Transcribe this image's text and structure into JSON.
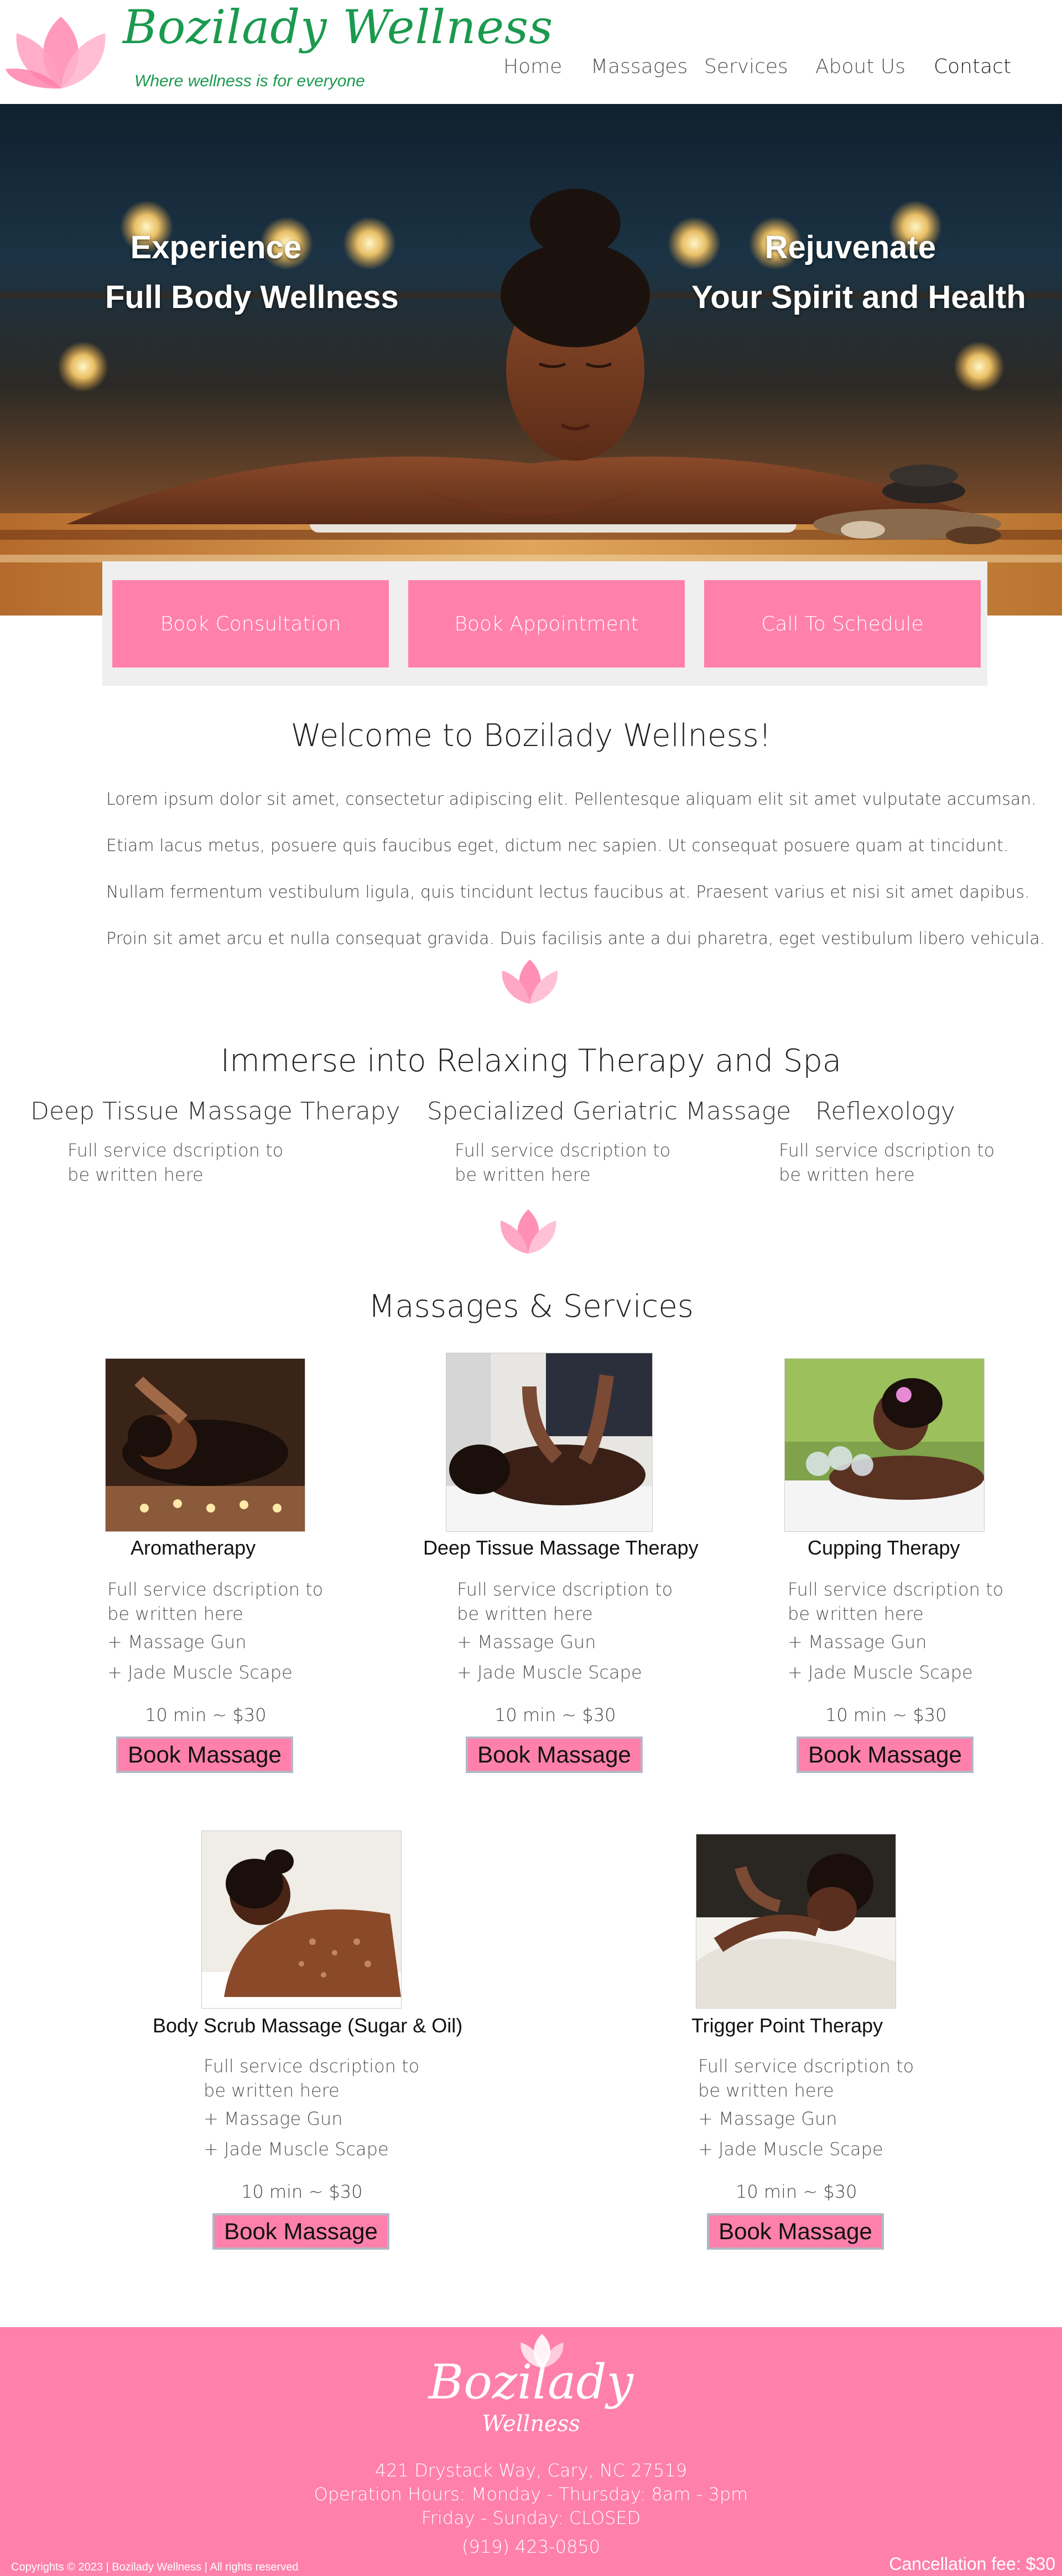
{
  "header": {
    "brand_name": "Bozilady Wellness",
    "tagline": "Where wellness is for everyone",
    "nav": [
      "Home",
      "Massages",
      "Services",
      "About Us",
      "Contact"
    ],
    "colors": {
      "brand_green": "#1a9a4e",
      "accent_pink": "#ff80ab"
    }
  },
  "hero": {
    "left_line1": "Experience",
    "left_line2": "Full Body Wellness",
    "right_line1": "Rejuvenate",
    "right_line2": "Your Spirit and Health"
  },
  "cta": [
    "Book Consultation",
    "Book Appointment",
    "Call To Schedule"
  ],
  "welcome": {
    "title": "Welcome to Bozilady Wellness!",
    "paragraphs": [
      "Lorem ipsum dolor sit amet, consectetur adipiscing elit. Pellentesque aliquam elit sit amet vulputate accumsan.",
      "Etiam lacus metus, posuere quis faucibus eget, dictum nec sapien. Ut consequat posuere quam at tincidunt.",
      "Nullam fermentum vestibulum ligula, quis tincidunt lectus faucibus at. Praesent varius et nisi sit amet dapibus.",
      "Proin sit amet arcu et nulla consequat gravida. Duis facilisis ante a dui pharetra, eget vestibulum libero vehicula."
    ]
  },
  "therapy": {
    "title": "Immerse into Relaxing Therapy and Spa",
    "items": [
      {
        "name": "Deep Tissue Massage Therapy",
        "desc": "Full service dscription to be written here"
      },
      {
        "name": "Specialized Geriatric Massage",
        "desc": "Full service dscription to be written here"
      },
      {
        "name": "Reflexology",
        "desc": "Full service dscription to be written here"
      }
    ]
  },
  "services": {
    "title": "Massages & Services",
    "items": [
      {
        "name": "Aromatherapy",
        "desc": "Full service dscription to be written here",
        "extra1": "+ Massage Gun",
        "extra2": "+ Jade Muscle Scape",
        "price": "10 min ~ $30",
        "button": "Book Massage"
      },
      {
        "name": "Deep Tissue Massage Therapy",
        "desc": "Full service dscription to be written here",
        "extra1": "+ Massage Gun",
        "extra2": "+ Jade Muscle Scape",
        "price": "10 min ~ $30",
        "button": "Book Massage"
      },
      {
        "name": "Cupping Therapy",
        "desc": "Full service dscription to be written here",
        "extra1": "+ Massage Gun",
        "extra2": "+ Jade Muscle Scape",
        "price": "10 min ~ $30",
        "button": "Book Massage"
      },
      {
        "name": "Body Scrub Massage (Sugar & Oil)",
        "desc": "Full service dscription to be written here",
        "extra1": "+ Massage Gun",
        "extra2": "+ Jade Muscle Scape",
        "price": "10 min ~ $30",
        "button": "Book Massage"
      },
      {
        "name": "Trigger Point Therapy",
        "desc": "Full service dscription to be written here",
        "extra1": "+ Massage Gun",
        "extra2": "+ Jade Muscle Scape",
        "price": "10 min ~ $30",
        "button": "Book Massage"
      }
    ]
  },
  "footer": {
    "brand_top": "Bozilady",
    "brand_bottom": "Wellness",
    "address": "421 Drystack Way, Cary, NC 27519",
    "hours1": "Operation Hours:  Monday - Thursday: 8am - 3pm",
    "hours2": "Friday - Sunday: CLOSED",
    "phone": "(919) 423-0850",
    "copyright": "Copyrights © 2023 | Bozilady Wellness | All rights reserved",
    "fee": "Cancellation fee: $30"
  }
}
